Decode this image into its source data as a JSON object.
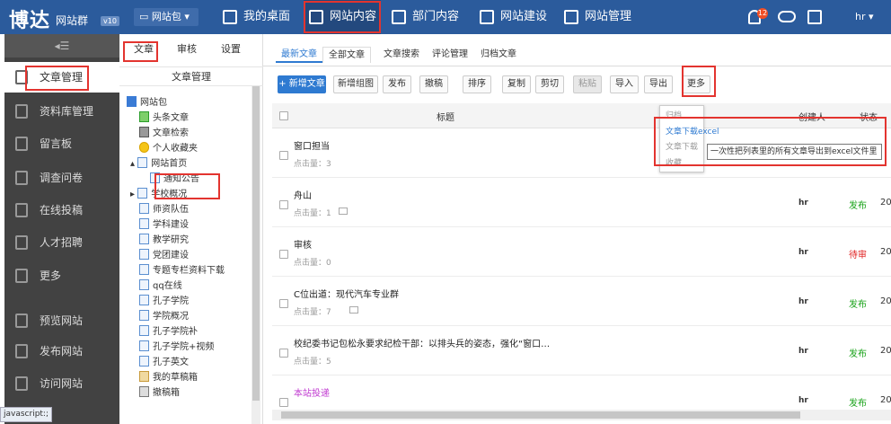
{
  "header": {
    "logo": "博达",
    "logo_sub": "网站群",
    "version": "v10",
    "site_select": "网站包",
    "nav": [
      "我的桌面",
      "网站内容",
      "部门内容",
      "网站建设",
      "网站管理"
    ],
    "notification_count": "12",
    "user": "hr"
  },
  "sidebar": {
    "items": [
      "文章管理",
      "资料库管理",
      "留言板",
      "调查问卷",
      "在线投稿",
      "人才招聘",
      "更多",
      "预览网站",
      "发布网站",
      "访问网站"
    ]
  },
  "tree": {
    "tabs": [
      "文章",
      "审核",
      "设置"
    ],
    "title": "文章管理",
    "items": [
      "网站包",
      "头条文章",
      "文章检索",
      "个人收藏夹",
      "网站首页",
      "通知公告",
      "学校概况",
      "师资队伍",
      "学科建设",
      "教学研究",
      "党团建设",
      "专题专栏资料下载",
      "qq在线",
      "孔子学院",
      "学院概况",
      "孔子学院补",
      "孔子学院+视频",
      "孔子英文",
      "我的草稿箱",
      "撤稿箱"
    ]
  },
  "main": {
    "tabs": [
      "最新文章",
      "全部文章",
      "文章搜索",
      "评论管理",
      "归档文章"
    ],
    "toolbar": [
      "+ 新增文章",
      "新增组图",
      "发布",
      "撤稿",
      "排序",
      "复制",
      "剪切",
      "粘贴",
      "导入",
      "导出",
      "更多"
    ],
    "columns": {
      "title": "标题",
      "creator": "创建人",
      "status": "状态"
    },
    "rows": [
      {
        "title": "窗口担当",
        "hits": "点击量：3",
        "creator": "",
        "status": "",
        "date": ""
      },
      {
        "title": "舟山",
        "hits": "点击量：1",
        "creator": "hr",
        "status": "发布",
        "date": "20"
      },
      {
        "title": "审核",
        "hits": "点击量：0",
        "creator": "hr",
        "status": "待审",
        "date": "20"
      },
      {
        "title": "C位出道：现代汽车专业群",
        "hits": "点击量：7",
        "creator": "hr",
        "status": "发布",
        "date": "20"
      },
      {
        "title": "校纪委书记包松永要求纪检干部：以排头兵的姿态，强化“窗口…",
        "hits": "点击量：5",
        "creator": "hr",
        "status": "发布",
        "date": "20"
      },
      {
        "title": "本站投递",
        "hits": "",
        "creator": "hr",
        "status": "发布",
        "date": "20"
      }
    ],
    "dropdown": [
      "归档",
      "文章下载excel",
      "文章下载",
      "收藏"
    ],
    "tooltip": "一次性把列表里的所有文章导出到excel文件里"
  },
  "statusbar": "javascript:;",
  "colors": {
    "topbar": "#2b5b9c",
    "sidebar": "#424242",
    "accent": "#2e7ad1",
    "published": "#1aa31a",
    "pending": "#e02020",
    "highlight": "#e3342f"
  }
}
